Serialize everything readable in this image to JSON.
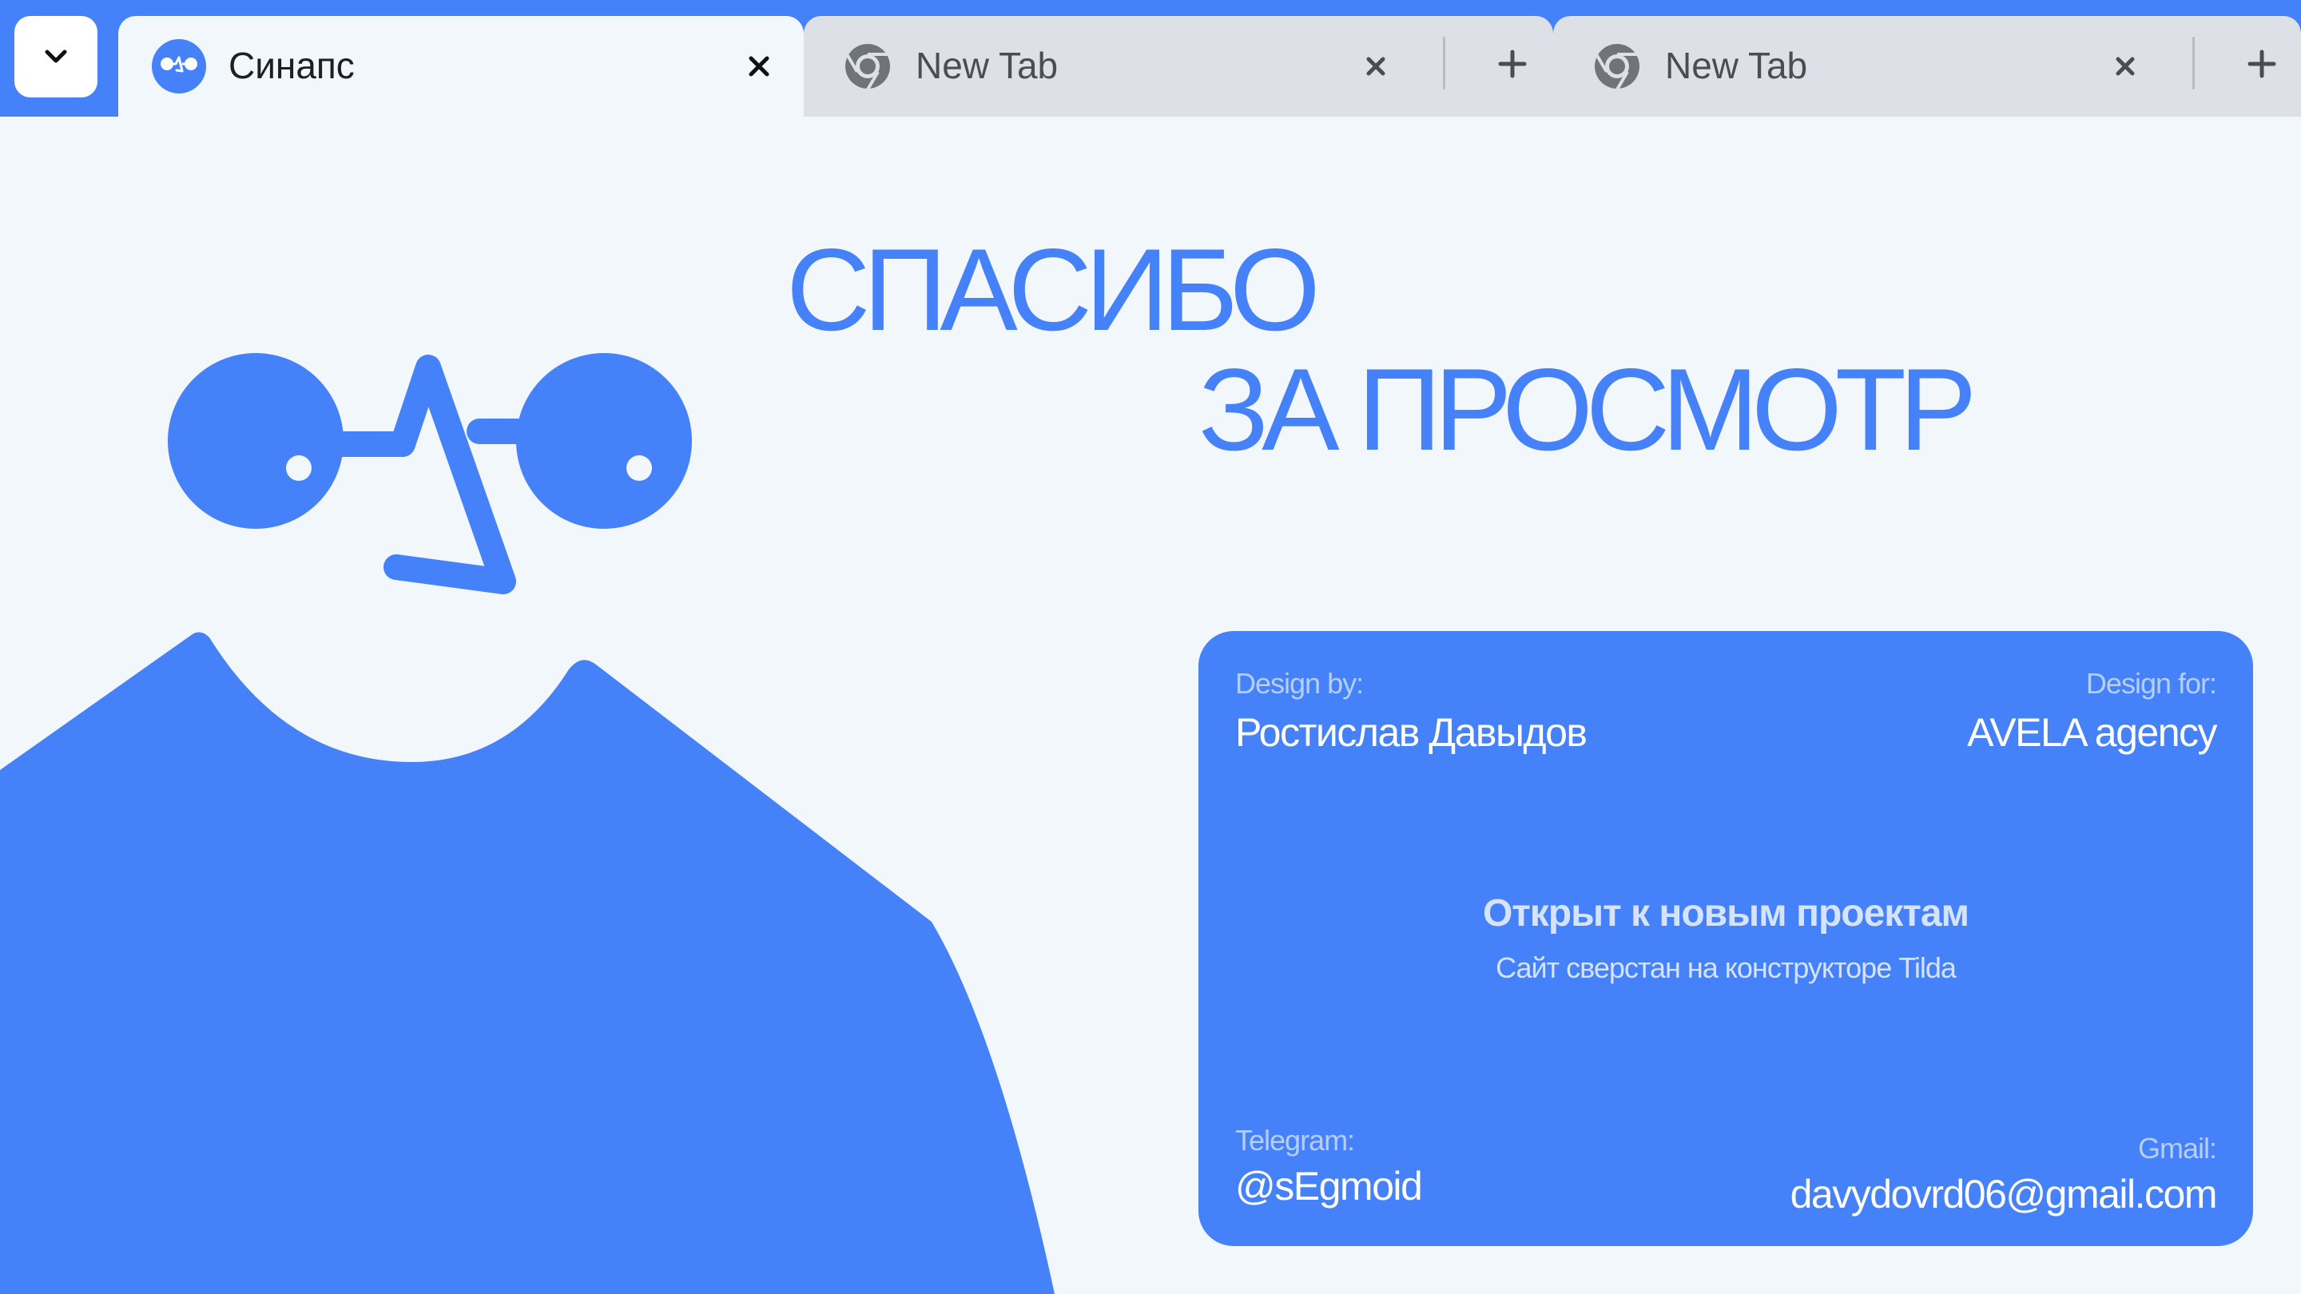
{
  "browser": {
    "menu_button_icon": "chevron-down-icon",
    "tabs": [
      {
        "title": "Синапс",
        "favicon": "synapse-face-logo",
        "active": true
      },
      {
        "title": "New Tab",
        "favicon": "chrome-icon",
        "active": false
      },
      {
        "title": "New Tab",
        "favicon": "chrome-icon",
        "active": false
      }
    ]
  },
  "hero": {
    "line1": "СПАСИБО",
    "line2": "ЗА ПРОСМОТР"
  },
  "card": {
    "design_by_label": "Design by:",
    "design_by_value": "Ростислав Давыдов",
    "design_for_label": "Design for:",
    "design_for_value": "AVELA agency",
    "center_title": "Открыт к новым проектам",
    "center_subtitle": "Сайт сверстан на конструкторе Tilda",
    "telegram_label": "Telegram:",
    "telegram_value": "@sEgmoid",
    "gmail_label": "Gmail:",
    "gmail_value": "davydovrd06@gmail.com"
  },
  "colors": {
    "accent": "#4581f8",
    "page_background": "#f2f7fc",
    "inactive_tab": "#dde1e7",
    "card_label": "#b6cefc"
  }
}
